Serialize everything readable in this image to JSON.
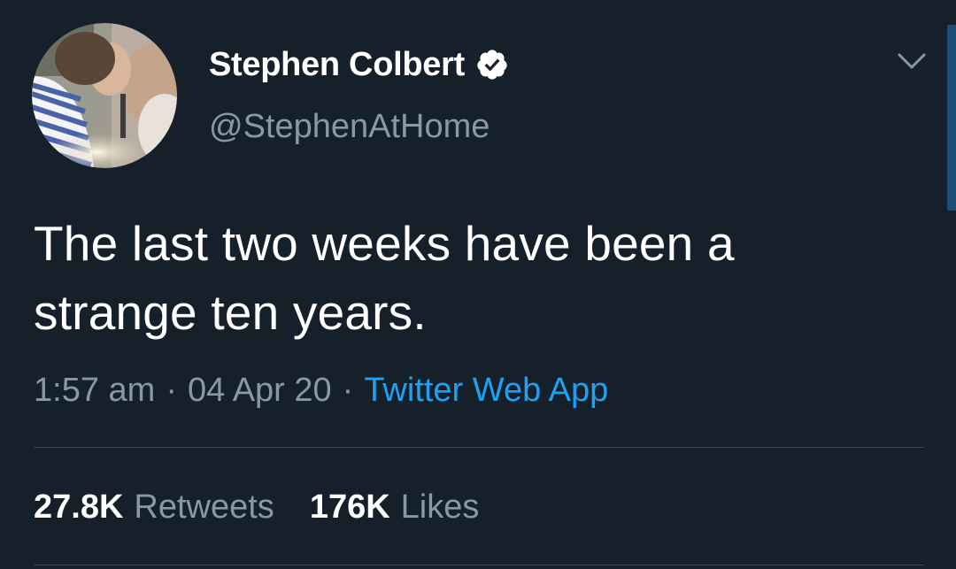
{
  "tweet": {
    "author": {
      "display_name": "Stephen Colbert",
      "handle": "@StephenAtHome",
      "verified_icon": "verified-badge-icon",
      "avatar": "profile-photo"
    },
    "text_lines": [
      "The last two weeks have been a",
      "strange ten years."
    ],
    "meta": {
      "time": "1:57 am",
      "separator": "·",
      "date": "04 Apr 20",
      "source": "Twitter Web App"
    },
    "stats": {
      "retweets_count": "27.8K",
      "retweets_label": "Retweets",
      "likes_count": "176K",
      "likes_label": "Likes"
    },
    "menu_icon": "chevron-down-icon"
  },
  "colors": {
    "background": "#15202b",
    "primary_text": "#ffffff",
    "secondary_text": "#8899a6",
    "link": "#1da1f2",
    "divider": "#38444d"
  }
}
